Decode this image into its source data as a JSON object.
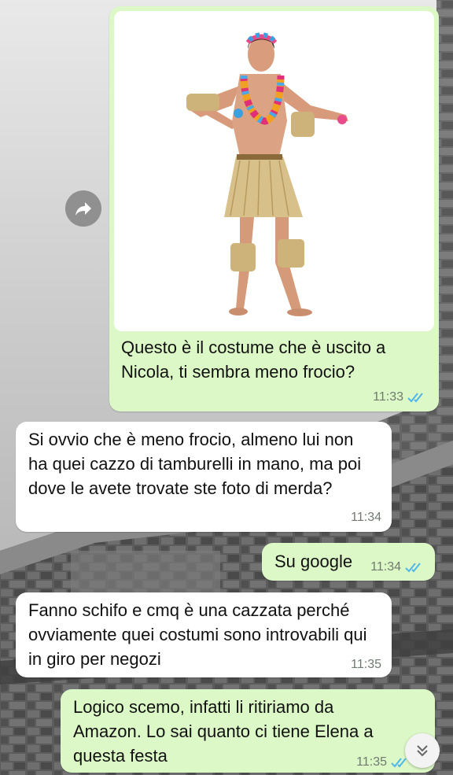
{
  "chat": {
    "messages": [
      {
        "direction": "out",
        "type": "image",
        "image": "hawaiian-costume-man",
        "caption": "Questo è il costume che è uscito a Nicola, ti sembra meno frocio?",
        "time": "11:33",
        "status": "read"
      },
      {
        "direction": "in",
        "text": "Si ovvio che è meno frocio, almeno lui non ha quei cazzo di tamburelli in mano, ma poi dove le avete trovate ste foto di merda?",
        "time": "11:34"
      },
      {
        "direction": "out",
        "text": "Su google",
        "time": "11:34",
        "status": "read"
      },
      {
        "direction": "in",
        "text": "Fanno schifo e cmq è una cazzata perché ovviamente quei costumi sono introvabili qui in giro per negozi",
        "time": "11:35"
      },
      {
        "direction": "out",
        "text": "Logico scemo, infatti li ritiriamo da Amazon. Lo sai quanto ci tiene Elena a questa festa",
        "time": "11:35",
        "status": "read"
      }
    ]
  },
  "icons": {
    "forward": "forward-arrow-icon",
    "scroll_down": "double-chevron-down-icon",
    "read_receipt": "double-check-icon"
  },
  "colors": {
    "outgoing_bubble": "#dcf8c6",
    "incoming_bubble": "#ffffff",
    "read_ticks": "#4fb6ec",
    "timestamp": "#6f7a6f"
  }
}
